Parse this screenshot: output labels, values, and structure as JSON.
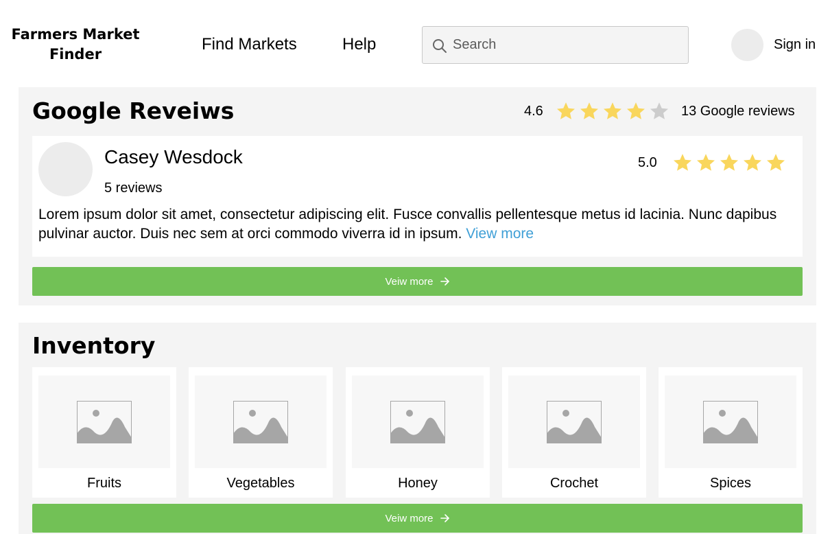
{
  "header": {
    "logo_line1": "Farmers Market",
    "logo_line2": "Finder",
    "nav": [
      {
        "label": "Find Markets"
      },
      {
        "label": "Help"
      }
    ],
    "search_placeholder": "Search",
    "signin_label": "Sign in"
  },
  "reviews": {
    "title": "Google Reveiws",
    "rating": "4.6",
    "stars_filled": 4,
    "stars_total": 5,
    "count_label": "13 Google reviews",
    "review": {
      "name": "Casey Wesdock",
      "review_count": "5 reviews",
      "rating": "5.0",
      "stars_filled": 5,
      "text": "Lorem ipsum dolor sit amet, consectetur adipiscing elit. Fusce convallis pellentesque metus id lacinia. Nunc dapibus pulvinar auctor. Duis nec sem at orci commodo viverra id in ipsum. ",
      "more_label": "View more"
    },
    "button_label": "Veiw more"
  },
  "inventory": {
    "title": "Inventory",
    "items": [
      {
        "label": "Fruits"
      },
      {
        "label": "Vegetables"
      },
      {
        "label": "Honey"
      },
      {
        "label": "Crochet"
      },
      {
        "label": "Spices"
      }
    ],
    "button_label": "Veiw more"
  },
  "colors": {
    "star_filled": "#f9d65c",
    "star_empty": "#cccccc",
    "button_green": "#72c156",
    "link_blue": "#3f9fd6",
    "panel_bg": "#f4f4f4"
  },
  "icons": {
    "search": "search-icon",
    "star": "star-icon",
    "arrow": "arrow-right-icon",
    "image": "image-placeholder-icon"
  }
}
